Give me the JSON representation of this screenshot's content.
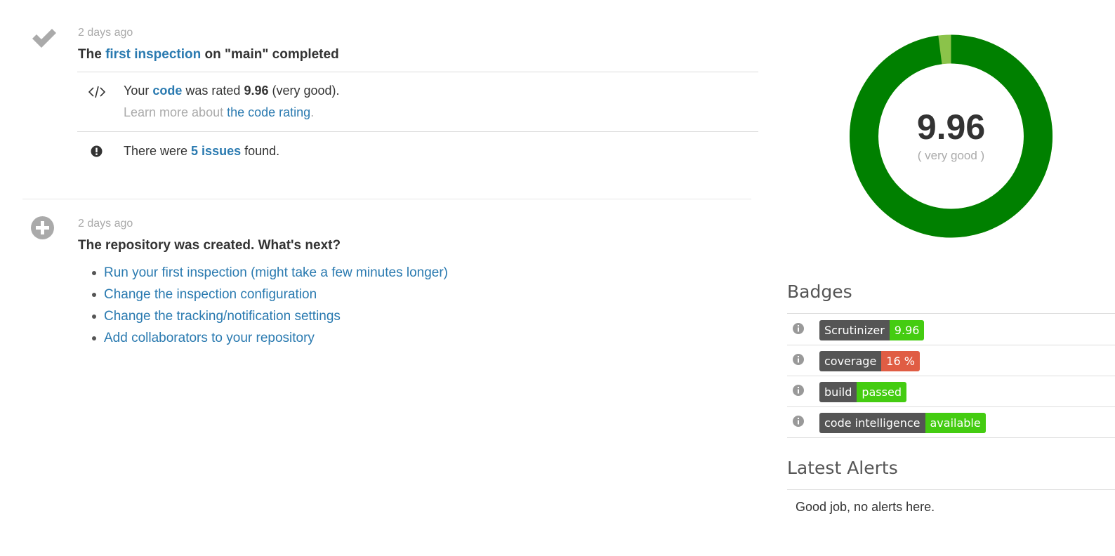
{
  "events": [
    {
      "time": "2 days ago",
      "title_prefix": "The ",
      "title_link": "first inspection",
      "title_suffix": " on \"main\" completed",
      "rating": {
        "prefix": "Your ",
        "code_link": "code",
        "middle": " was rated ",
        "score": "9.96",
        "suffix": " (very good).",
        "learn_prefix": "Learn more about ",
        "learn_link": "the code rating",
        "learn_suffix": "."
      },
      "issues": {
        "prefix": "There were ",
        "link": "5 issues",
        "suffix": " found."
      }
    },
    {
      "time": "2 days ago",
      "title": "The repository was created. What's next?",
      "next_steps": [
        "Run your first inspection (might take a few minutes longer)",
        "Change the inspection configuration",
        "Change the tracking/notification settings",
        "Add collaborators to your repository"
      ]
    }
  ],
  "gauge": {
    "score": "9.96",
    "label": "( very good )",
    "fraction": 0.996,
    "color_main": "#008000",
    "color_rest": "#8bc34a"
  },
  "badges_section": {
    "title": "Badges",
    "items": [
      {
        "left": "Scrutinizer",
        "right": "9.96",
        "right_color": "#44cc11"
      },
      {
        "left": "coverage",
        "right": "16 %",
        "right_color": "#e05d44"
      },
      {
        "left": "build",
        "right": "passed",
        "right_color": "#44cc11"
      },
      {
        "left": "code intelligence",
        "right": "available",
        "right_color": "#44cc11"
      }
    ]
  },
  "alerts_section": {
    "title": "Latest Alerts",
    "empty_text": "Good job, no alerts here."
  },
  "colors": {
    "link": "#2a7ab0",
    "muted": "#aaaaaa",
    "icon_gray": "#aaaaaa"
  }
}
